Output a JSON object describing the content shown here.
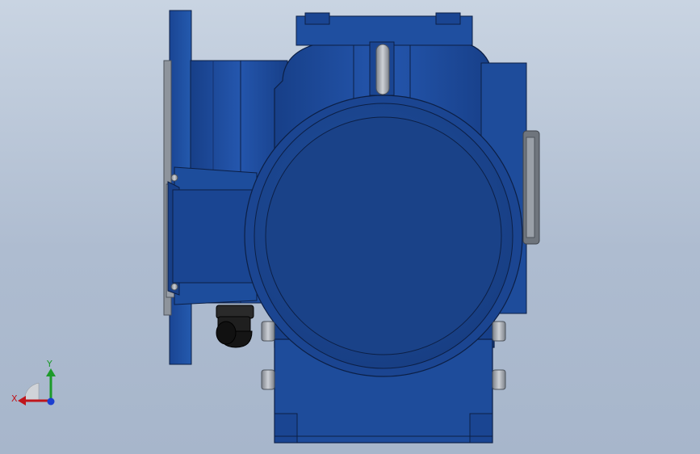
{
  "viewport": {
    "background_top": "#c9d4e2",
    "background_bottom": "#a7b6cb"
  },
  "model": {
    "body_color": "#1f4fa0",
    "body_dark": "#163a7a",
    "edge_color": "#0c1f45",
    "metal_color": "#9aa0a8",
    "rubber_color": "#1a1a1a"
  },
  "triad": {
    "x_label": "X",
    "y_label": "Y",
    "x_color": "#c0161c",
    "y_color": "#1d9a2a",
    "z_color": "#1c3fd0"
  }
}
